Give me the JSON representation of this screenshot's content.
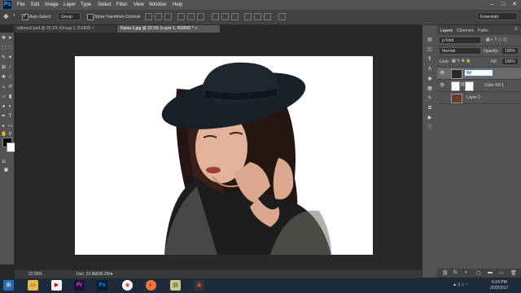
{
  "app": {
    "logo": "Ps",
    "menu": [
      "File",
      "Edit",
      "Image",
      "Layer",
      "Type",
      "Select",
      "Filter",
      "View",
      "Window",
      "Help"
    ],
    "window_controls": [
      "–",
      "□",
      "✕"
    ]
  },
  "options_bar": {
    "auto_select_label": "Auto-Select:",
    "auto_select_value": "Group",
    "show_transform_label": "Show Transform Controls",
    "workspace": "Essentials"
  },
  "tabs": [
    {
      "label": "istibum2.psd @ 20.1% (Group 1, RGB/8) ×",
      "active": false
    },
    {
      "label": "Raisa-1.jpg @ 22.5% (Layer 1, RGB/8) * ×",
      "active": true
    }
  ],
  "status": {
    "zoom": "22.55%",
    "doc": "Doc: 22.8M/35.2M"
  },
  "panel": {
    "tabs": [
      "Layers",
      "Channels",
      "Paths"
    ],
    "kind_label": "ρ Kind",
    "blend_mode": "Normal",
    "opacity_label": "Opacity:",
    "opacity_value": "100%",
    "lock_label": "Lock:",
    "fill_label": "Fill:",
    "fill_value": "100%",
    "layers": [
      {
        "name": "Wi",
        "editing": true
      },
      {
        "name": "Color Fill 1",
        "editing": false
      },
      {
        "name": "Layer 0",
        "editing": false
      }
    ],
    "footer_icons": [
      "⛓",
      "fx",
      "◐",
      "▢",
      "▬",
      "▭",
      "🗑"
    ]
  },
  "taskbar": {
    "clock_time": "6:24 PM",
    "clock_date": "2/20/2017"
  },
  "colors": {
    "menubar": "#535353",
    "panel": "#535353",
    "canvas_bg": "#282828",
    "taskbar": "#1c2a3a"
  }
}
